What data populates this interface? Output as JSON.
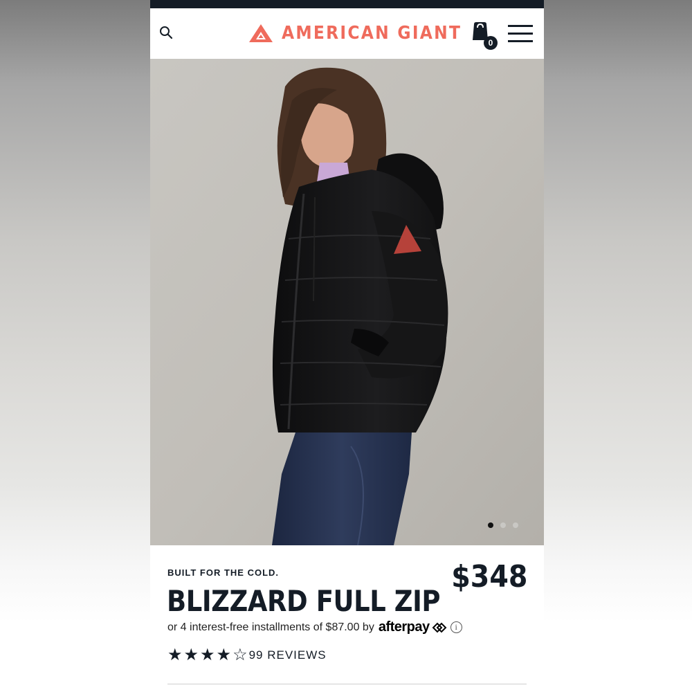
{
  "brand": {
    "name": "AMERICAN GIANT",
    "accent_color": "#ef6b5c",
    "dark_color": "#141c26"
  },
  "header": {
    "search_icon": "search-icon",
    "cart_icon": "shopping-bag-icon",
    "cart_count": "0",
    "menu_icon": "hamburger-menu-icon"
  },
  "gallery": {
    "image_subject": "Woman wearing a black quilted hooded full-zip jacket with jeans",
    "total_images": 3,
    "active_index": 0
  },
  "product": {
    "tagline": "BUILT FOR THE COLD.",
    "name": "BLIZZARD FULL ZIP",
    "price": "$348",
    "installments_text": "or 4 interest-free installments of $87.00 by",
    "payment_provider": "afterpay",
    "info_icon": "ⓘ",
    "rating_value": 4,
    "rating_max": 5,
    "reviews_label": "99 REVIEWS"
  }
}
